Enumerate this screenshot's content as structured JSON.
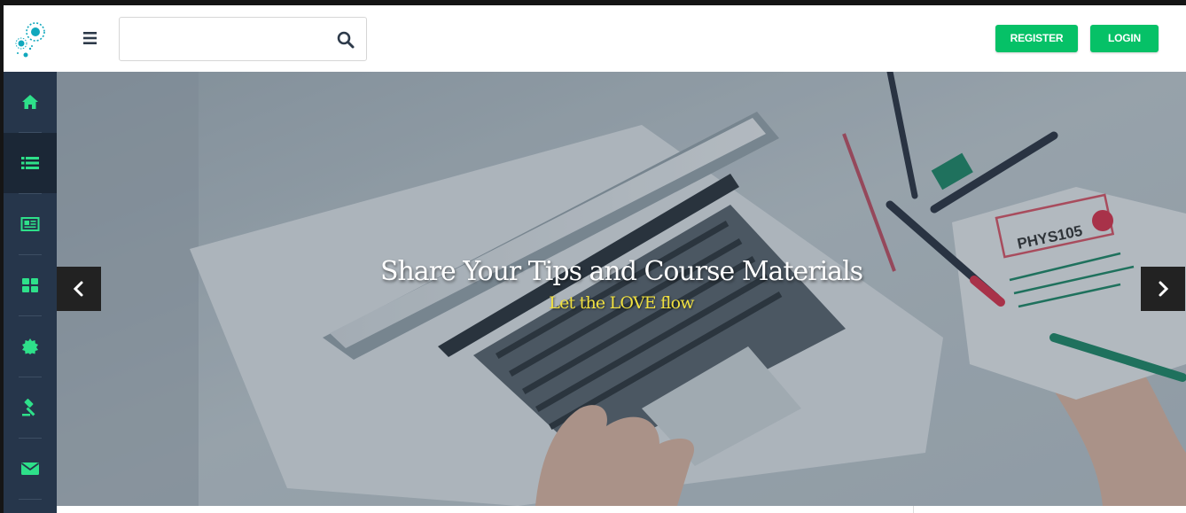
{
  "header": {
    "search": {
      "placeholder": "",
      "value": ""
    },
    "register_label": "REGISTER",
    "login_label": "LOGIN"
  },
  "sidebar": {
    "items": [
      {
        "icon": "home-icon",
        "active": false
      },
      {
        "icon": "list-icon",
        "active": true
      },
      {
        "icon": "newspaper-icon",
        "active": false
      },
      {
        "icon": "grid-icon",
        "active": false
      },
      {
        "icon": "badge-icon",
        "active": false
      },
      {
        "icon": "gavel-icon",
        "active": false
      },
      {
        "icon": "envelope-icon",
        "active": false
      }
    ]
  },
  "hero": {
    "title": "Share Your Tips and Course Materials",
    "subtitle": "Let the LOVE flow",
    "note_label": "PHYS105"
  },
  "colors": {
    "accent_green": "#06c167",
    "sidebar_bg": "#26364b",
    "sidebar_active_bg": "#1b2736",
    "sidebar_icon": "#2ee08a",
    "subtitle": "#f0e040",
    "logo_teal": "#10a8bd"
  }
}
